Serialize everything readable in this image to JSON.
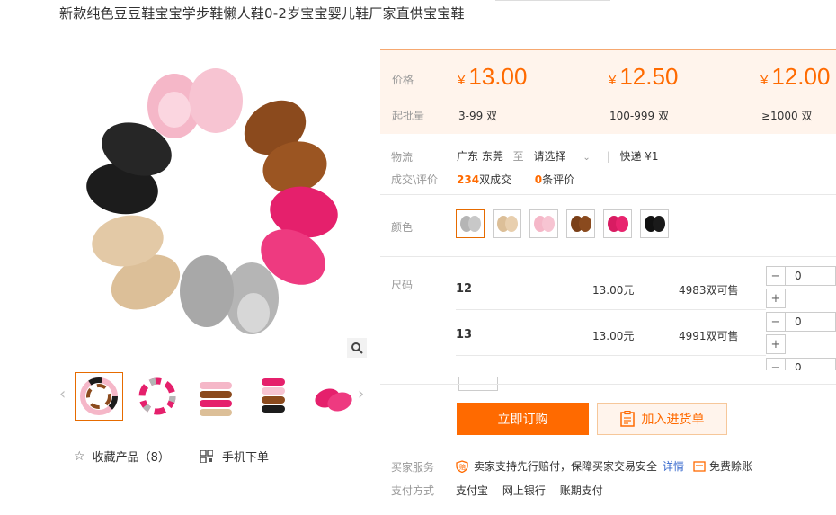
{
  "product": {
    "title": "新款纯色豆豆鞋宝宝学步鞋懒人鞋0-2岁宝宝婴儿鞋厂家直供宝宝鞋"
  },
  "gallery": {
    "favorite_label": "收藏产品（8）",
    "mobile_label": "手机下单",
    "main_image": "baby-moccasins-circle",
    "thumbnails": [
      "rainbow-moccasins",
      "moccasins-circle",
      "stacked-moccasins",
      "stacked-moccasins-2",
      "pink-moccasins-pair"
    ]
  },
  "pricing": {
    "price_label": "价格",
    "moq_label": "起批量",
    "currency": "¥",
    "tiers": [
      {
        "price": "13.00",
        "range": "3-99 双"
      },
      {
        "price": "12.50",
        "range": "100-999 双"
      },
      {
        "price": "12.00",
        "range": "≥1000 双"
      }
    ]
  },
  "logistics": {
    "label": "物流",
    "origin": "广东 东莞",
    "to": "至",
    "destination": "请选择",
    "express": "快递 ¥1"
  },
  "deals": {
    "label": "成交\\评价",
    "count": "234",
    "count_suffix": "双成交",
    "reviews": "0",
    "reviews_suffix": "条评价"
  },
  "color": {
    "label": "颜色",
    "options": [
      "#c8c8c8",
      "#e8cfae",
      "#f4b8c8",
      "#8a4a1e",
      "#e8246e",
      "#1a1a1a"
    ],
    "selected_index": 0
  },
  "size": {
    "label": "尺码",
    "rows": [
      {
        "size": "12",
        "price": "13.00元",
        "stock": "4983双可售",
        "qty": "0"
      },
      {
        "size": "13",
        "price": "13.00元",
        "stock": "4991双可售",
        "qty": "0"
      },
      {
        "size": "",
        "price": "",
        "stock": "",
        "qty": "0"
      }
    ]
  },
  "actions": {
    "buy_now": "立即订购",
    "add_cart": "加入进货单"
  },
  "service": {
    "label": "买家服务",
    "guarantee": "卖家支持先行赔付，保障买家交易安全",
    "details": "详情",
    "free": "免费赊账"
  },
  "payment": {
    "label": "支付方式",
    "methods": [
      "支付宝",
      "网上银行",
      "账期支付"
    ]
  },
  "colors": {
    "accent": "#ff6a00",
    "price_bg": "#fff4ec"
  }
}
